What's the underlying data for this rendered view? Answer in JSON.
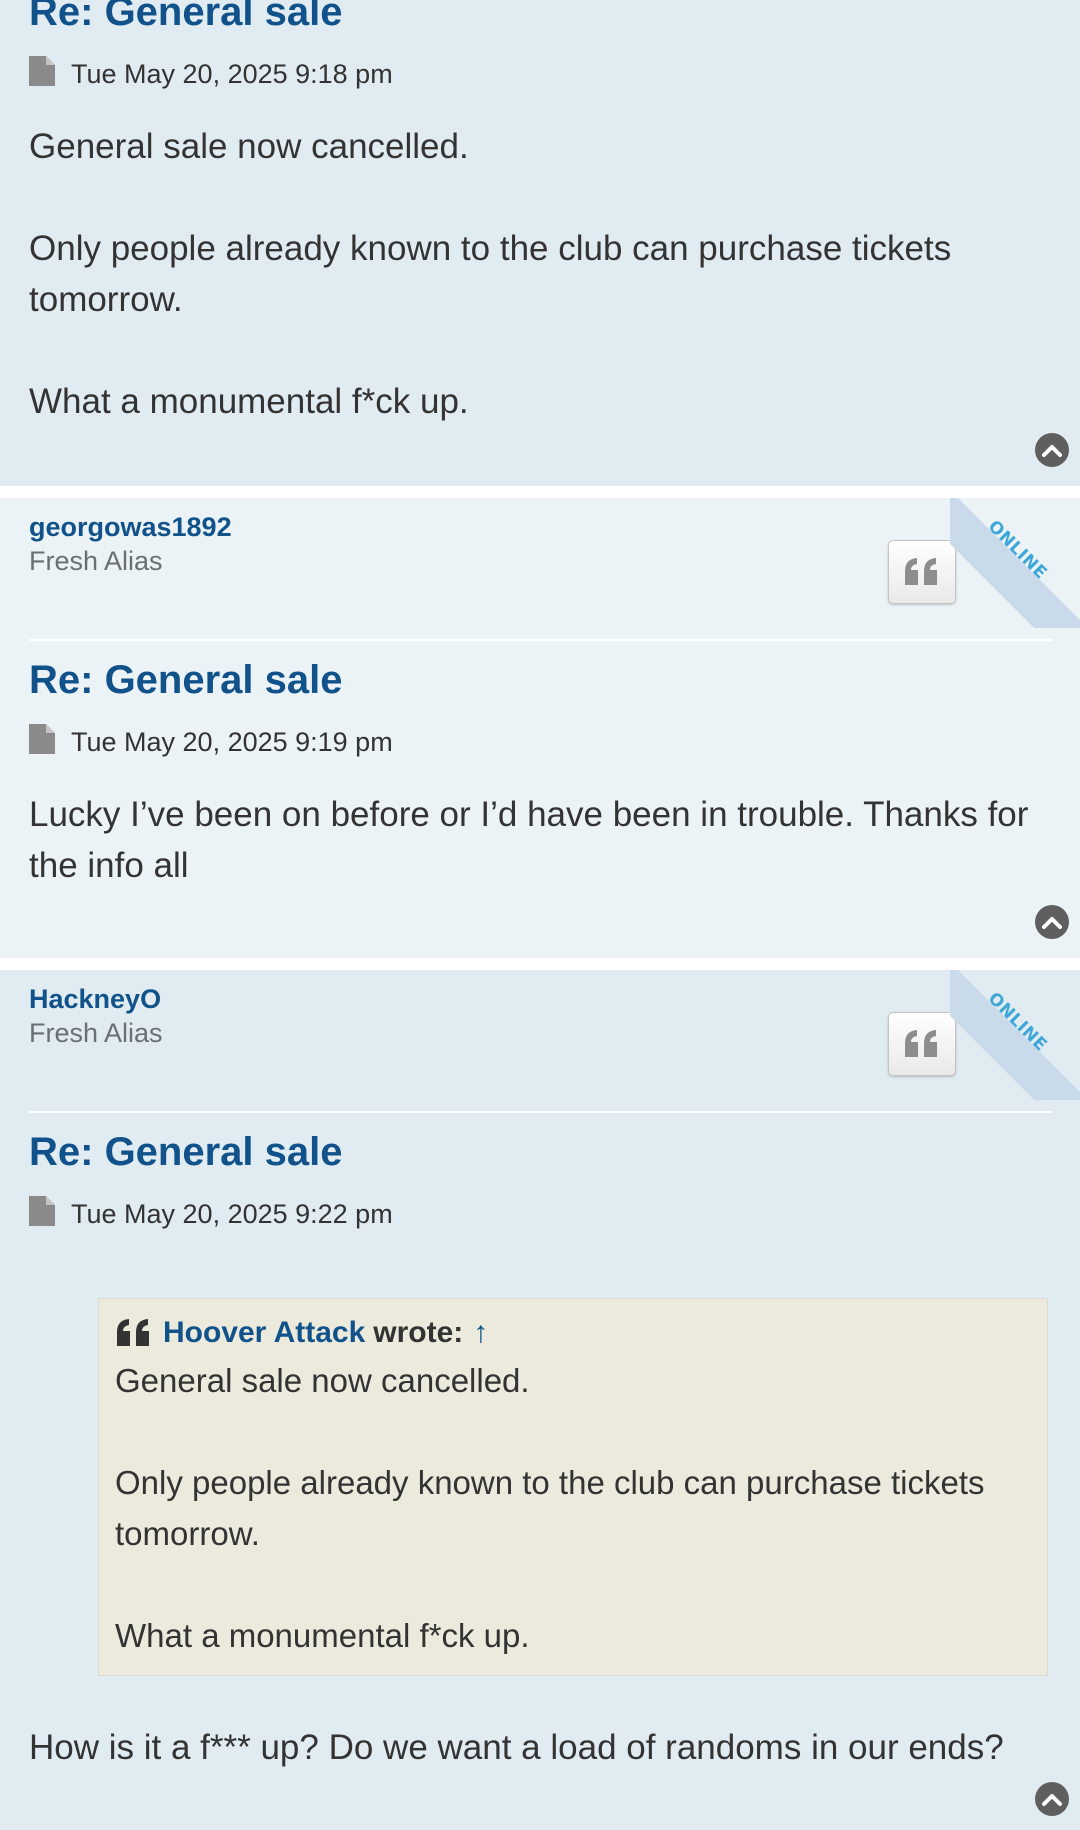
{
  "posts": [
    {
      "title": "Re: General sale",
      "timestamp": "Tue May 20, 2025 9:18 pm",
      "body": [
        "General sale now cancelled.",
        "Only people already known to the club can purchase tickets tomorrow.",
        "What a monumental f*ck up."
      ]
    },
    {
      "author": "georgowas1892",
      "rank": "Fresh Alias",
      "online_label": "ONLINE",
      "title": "Re: General sale",
      "timestamp": "Tue May 20, 2025 9:19 pm",
      "body": [
        "Lucky I’ve been on before or I’d have been in trouble. Thanks for the info all"
      ]
    },
    {
      "author": "HackneyO",
      "rank": "Fresh Alias",
      "online_label": "ONLINE",
      "title": "Re: General sale",
      "timestamp": "Tue May 20, 2025 9:22 pm",
      "quote": {
        "author": "Hoover Attack",
        "wrote": "wrote:",
        "arrow": "↑",
        "body": [
          "General sale now cancelled.",
          "Only people already known to the club can purchase tickets tomorrow.",
          "What a monumental f*ck up."
        ]
      },
      "body": [
        "How is it a f*** up? Do we want a load of randoms in our ends?"
      ]
    }
  ],
  "icons": {
    "file": "file-icon",
    "quote": "quote-icon",
    "top": "chevron-up-icon"
  },
  "colors": {
    "link": "#105289",
    "post_bg_1": "#e1ebf2",
    "post_bg_2": "#ecf3f7",
    "quote_bg": "#ebeadd",
    "online": "#3fa7d8"
  }
}
